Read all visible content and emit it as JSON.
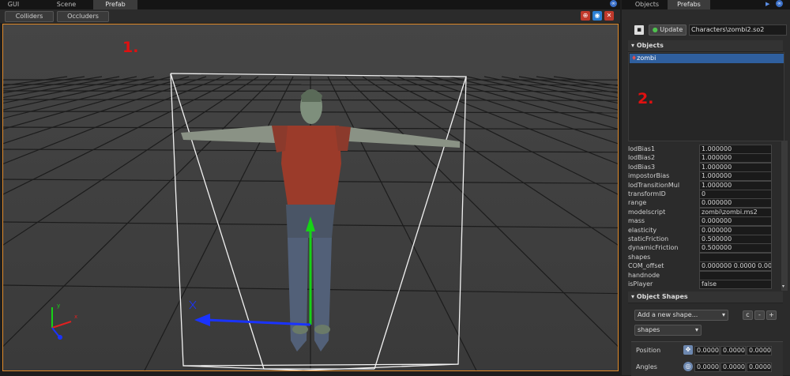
{
  "top_tabs": [
    "GUI",
    "Scene",
    "Prefab"
  ],
  "toolbar": {
    "colliders_label": "Colliders",
    "occluders_label": "Occluders"
  },
  "viewport": {
    "label_1": "1."
  },
  "right_tabs": [
    "Objects",
    "Prefabs"
  ],
  "prefab_bar": {
    "update_label": "Update",
    "path_value": "Characters\\zombi2.so2"
  },
  "objects_section": {
    "title": "Objects",
    "selected_item": "zombi",
    "label_2": "2."
  },
  "properties": [
    {
      "name": "lodBias1",
      "value": "1.000000"
    },
    {
      "name": "lodBias2",
      "value": "1.000000"
    },
    {
      "name": "lodBias3",
      "value": "1.000000"
    },
    {
      "name": "impostorBias",
      "value": "1.000000"
    },
    {
      "name": "lodTransitionMul",
      "value": "1.000000"
    },
    {
      "name": "transformID",
      "value": "0"
    },
    {
      "name": "range",
      "value": "0.000000"
    },
    {
      "name": "modelscript",
      "value": "zombi\\zombi.ms2"
    },
    {
      "name": "mass",
      "value": "0.000000"
    },
    {
      "name": "elasticity",
      "value": "0.000000"
    },
    {
      "name": "staticFriction",
      "value": "0.500000"
    },
    {
      "name": "dynamicFriction",
      "value": "0.500000"
    },
    {
      "name": "shapes",
      "value": ""
    },
    {
      "name": "COM_offset",
      "value": "0.000000  0.0000  0.000000"
    },
    {
      "name": "handnode",
      "value": ""
    },
    {
      "name": "isPlayer",
      "value": "false"
    }
  ],
  "object_shapes": {
    "title": "Object Shapes",
    "add_shape_placeholder": "Add a new shape...",
    "shapes_dropdown": "shapes",
    "buttons": [
      "c",
      "-",
      "+"
    ],
    "position_label": "Position",
    "position_values": [
      "0.00000",
      "0.00000",
      "0.00000"
    ],
    "angles_label": "Angles",
    "angles_values": [
      "0.00000",
      "0.00000",
      "0.00000"
    ]
  },
  "colors": {
    "accent_orange": "#e08a2a",
    "selection_blue": "#2f5f9e",
    "marker_red": "#e01010"
  }
}
